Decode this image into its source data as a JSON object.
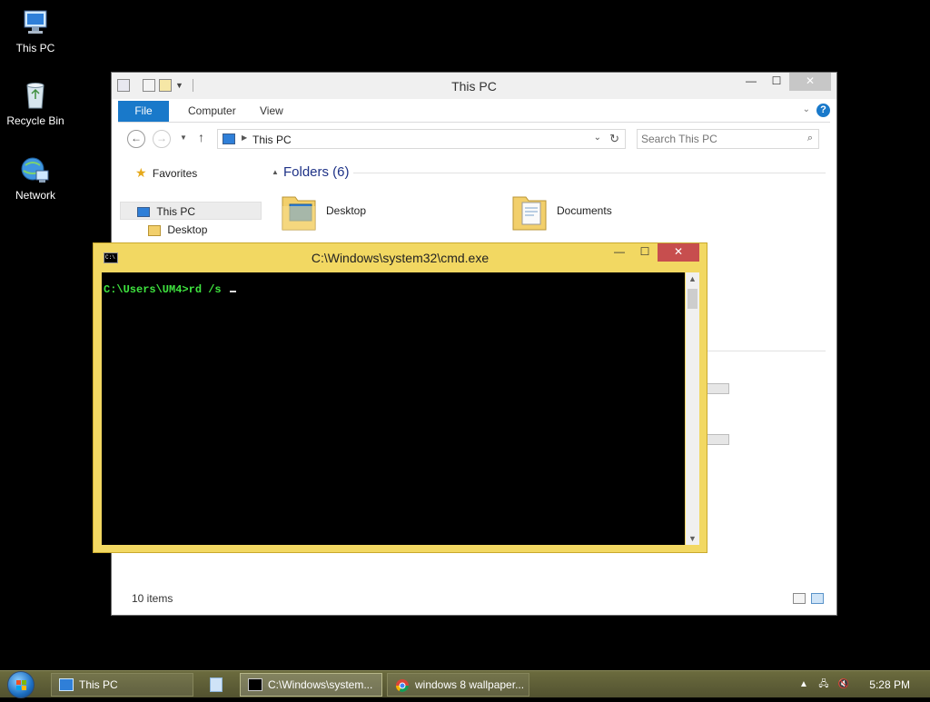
{
  "desktop": {
    "icons": [
      {
        "label": "This PC"
      },
      {
        "label": "Recycle Bin"
      },
      {
        "label": "Network"
      }
    ]
  },
  "explorer": {
    "title": "This PC",
    "ribbon_tabs": [
      "File",
      "Computer",
      "View"
    ],
    "address": "This PC",
    "search_placeholder": "Search This PC",
    "nav": {
      "favorites": "Favorites",
      "this_pc": "This PC",
      "desktop": "Desktop"
    },
    "folders_header": "Folders (6)",
    "folders": [
      "Desktop",
      "Documents"
    ],
    "status": "10 items"
  },
  "cmd": {
    "title": "C:\\Windows\\system32\\cmd.exe",
    "prompt_line": "C:\\Users\\UM4>rd /s "
  },
  "taskbar": {
    "buttons": [
      "This PC",
      "C:\\Windows\\system...",
      "windows 8 wallpaper..."
    ],
    "clock": "5:28 PM"
  },
  "colors": {
    "cmd_frame": "#f2d862",
    "ribbon_file": "#1979ca",
    "console_text": "#3fe43f"
  }
}
